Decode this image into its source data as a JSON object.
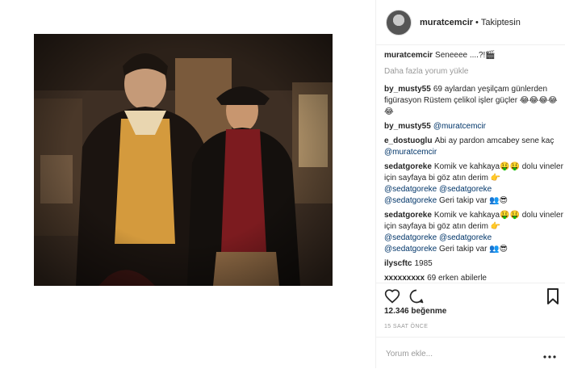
{
  "header": {
    "username": "muratcemcir",
    "separator": "•",
    "follow_status": "Takiptesin"
  },
  "caption": {
    "username": "muratcemcir",
    "text": "Seneeee ....?!🎬"
  },
  "load_more": "Daha fazla yorum yükle",
  "comments": [
    {
      "user": "by_musty55",
      "text": "69 aylardan yeşilçam günlerden figürasyon Rüstem çelikol işler güçler 😂😂😂😂😂"
    },
    {
      "user": "by_musty55",
      "mention": "@muratcemcir"
    },
    {
      "user": "e_dostuoglu",
      "text": "Abi ay pardon amcabey sene kaç",
      "mention": "@muratcemcir"
    },
    {
      "user": "sedatgoreke",
      "text": "Komik ve kahkaya🤑🤑 dolu vineler için sayfaya bi göz atın derim 👉",
      "mention1": "@sedatgoreke @sedatgoreke",
      "mention2": "@sedatgoreke",
      "tail": "Geri takip var 👥😎"
    },
    {
      "user": "sedatgoreke",
      "text": "Komik ve kahkaya🤑🤑 dolu vineler için sayfaya bi göz atın derim 👉",
      "mention1": "@sedatgoreke @sedatgoreke",
      "mention2": "@sedatgoreke",
      "tail": "Geri takip var 👥😎"
    },
    {
      "user": "ilyscftc",
      "text": "1985"
    },
    {
      "user": "xxxxxxxxx",
      "text": "69 erken abilerle"
    }
  ],
  "likes": "12.346 beğenme",
  "time_ago": "15 SAAT ÖNCE",
  "add_comment": {
    "placeholder": "Yorum ekle..."
  },
  "icons": [
    "heart-icon",
    "comment-icon",
    "bookmark-icon",
    "ellipsis-icon"
  ],
  "colors": {
    "text": "#262626",
    "muted": "#999999",
    "link": "#003569",
    "border": "#efefef"
  }
}
